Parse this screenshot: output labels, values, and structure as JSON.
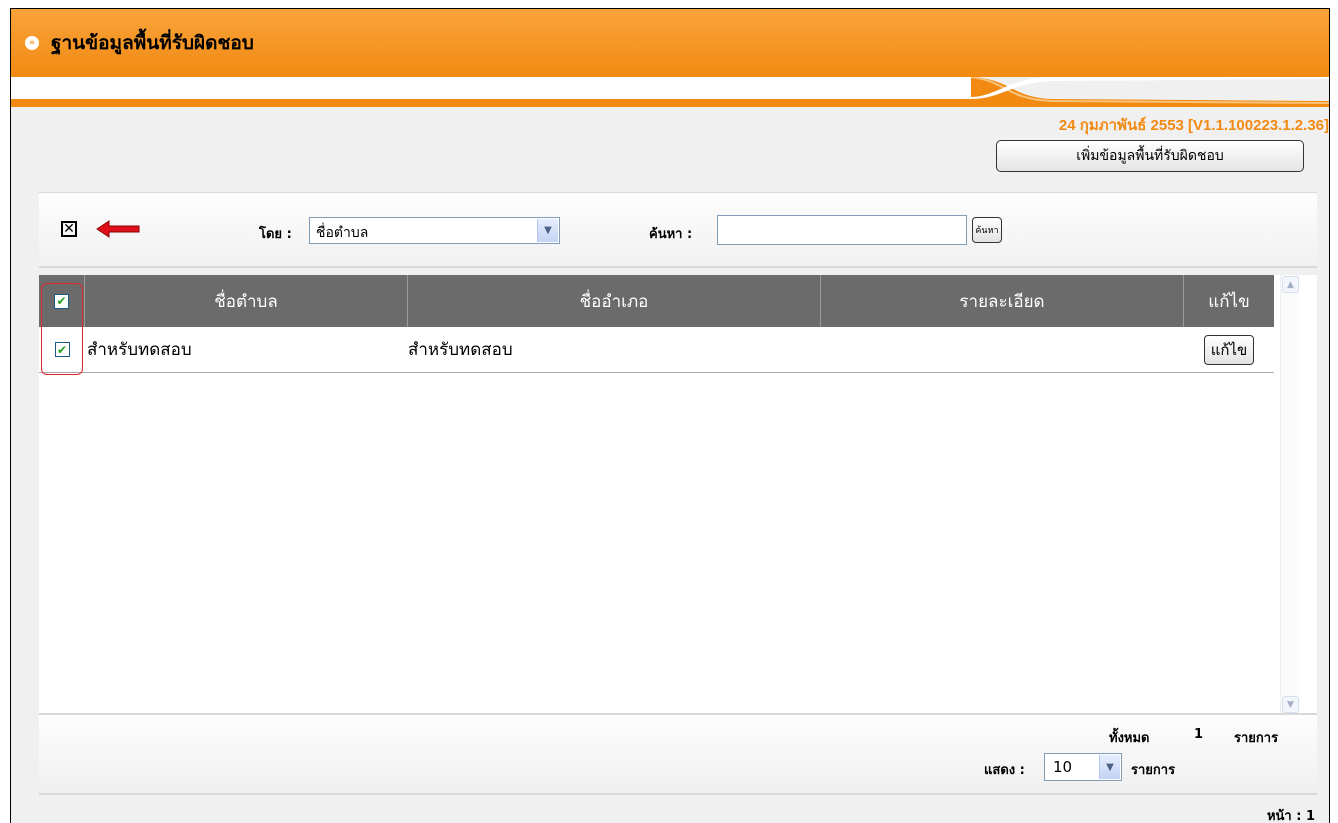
{
  "header": {
    "title": "ฐานข้อมูลพื้นที่รับผิดชอบ"
  },
  "version_text": "24 กุมภาพันธ์ 2553 [V1.1.100223.1.2.36]",
  "add_button_label": "เพิ่มข้อมูลพื้นที่รับผิดชอบ",
  "toolbar": {
    "close_symbol": "✕",
    "by_label": "โดย :",
    "by_selected": "ชื่อตำบล",
    "search_label": "ค้นหา :",
    "search_value": "",
    "search_button_label": "ค้นหา"
  },
  "table": {
    "columns": [
      "ชื่อตำบล",
      "ชื่ออำเภอ",
      "รายละเอียด",
      "แก้ไข"
    ],
    "rows": [
      {
        "checked": true,
        "subdistrict": "สำหรับทดสอบ",
        "district": "สำหรับทดสอบ",
        "detail": "",
        "edit_label": "แก้ไข"
      }
    ]
  },
  "footer": {
    "total_label": "ทั้งหมด",
    "total_count": "1",
    "total_unit": "รายการ",
    "show_label": "แสดง :",
    "show_value": "10",
    "show_unit": "รายการ",
    "page_text": "หน้า : 1"
  },
  "colors": {
    "header_orange": "#f28a12",
    "table_header": "#6b6b6b",
    "arrow_red": "#e0101a"
  },
  "icons": [
    "bullet-arrow-icon",
    "close-box-icon",
    "red-arrow-icon",
    "dropdown-arrow-icon",
    "check-icon"
  ]
}
